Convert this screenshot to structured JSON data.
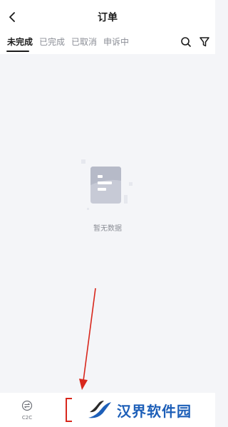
{
  "header": {
    "title": "订单",
    "back_icon": "chevron-left-icon"
  },
  "tabs": [
    {
      "label": "未完成",
      "active": true
    },
    {
      "label": "已完成",
      "active": false
    },
    {
      "label": "已取消",
      "active": false
    },
    {
      "label": "申诉中",
      "active": false
    }
  ],
  "actions": {
    "search_icon": "search-icon",
    "filter_icon": "filter-icon"
  },
  "empty_state": {
    "text": "暂无数据",
    "icon": "empty-document-icon"
  },
  "bottom_nav": {
    "c2c_label": "C2C"
  },
  "watermark": {
    "brand_text": "汉界软件园"
  },
  "colors": {
    "annotation_red": "#d8271c",
    "brand_blue": "#1d5fb8",
    "active_tab": "#1b1b1b",
    "inactive_tab": "#8b8e96"
  }
}
